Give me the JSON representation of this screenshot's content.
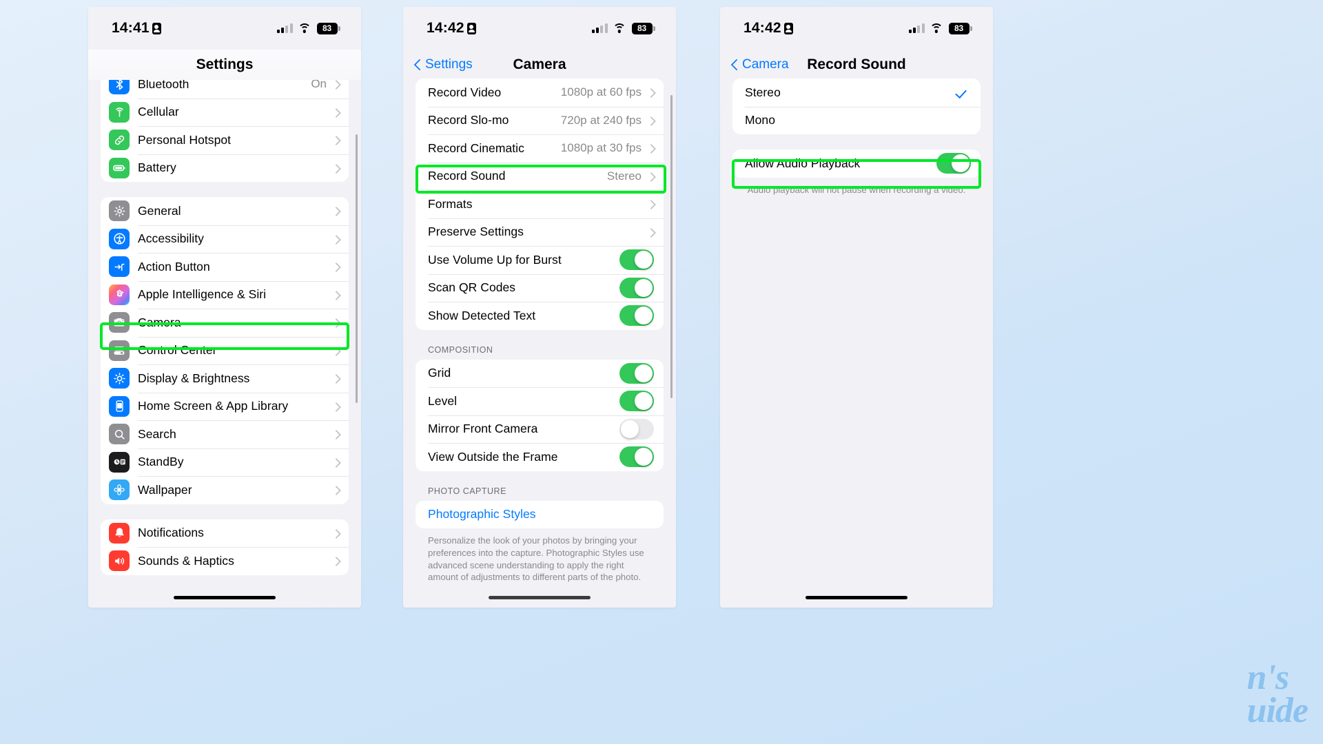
{
  "colors": {
    "accent_blue": "#047aff",
    "toggle_green": "#34c759",
    "highlight_green": "#00e826",
    "value_gray": "#8a8a8e",
    "page_bg": "#cfe4f8"
  },
  "watermark": {
    "line1": "n's",
    "line2": "uide"
  },
  "phone1": {
    "status": {
      "time": "14:41",
      "battery": "83",
      "lock_icon": "lock-portrait-icon",
      "signal_icon": "cellular-bars-icon",
      "wifi_icon": "wifi-icon"
    },
    "nav": {
      "title": "Settings"
    },
    "group1": [
      {
        "label": "Bluetooth",
        "value": "On",
        "icon": "bluetooth-icon",
        "icon_color": "#047aff"
      },
      {
        "label": "Cellular",
        "value": "",
        "icon": "cellular-antenna-icon",
        "icon_color": "#34c759"
      },
      {
        "label": "Personal Hotspot",
        "value": "",
        "icon": "hotspot-link-icon",
        "icon_color": "#34c759"
      },
      {
        "label": "Battery",
        "value": "",
        "icon": "battery-icon",
        "icon_color": "#34c759"
      }
    ],
    "group2": [
      {
        "label": "General",
        "value": "",
        "icon": "gear-icon",
        "icon_color": "#8e8e93"
      },
      {
        "label": "Accessibility",
        "value": "",
        "icon": "accessibility-icon",
        "icon_color": "#047aff"
      },
      {
        "label": "Action Button",
        "value": "",
        "icon": "action-button-icon",
        "icon_color": "#047aff"
      },
      {
        "label": "Apple Intelligence & Siri",
        "value": "",
        "icon": "apple-intelligence-icon",
        "icon_color": "gradient"
      },
      {
        "label": "Camera",
        "value": "",
        "icon": "camera-icon",
        "icon_color": "#8e8e93",
        "highlighted": true
      },
      {
        "label": "Control Center",
        "value": "",
        "icon": "control-center-icon",
        "icon_color": "#8e8e93"
      },
      {
        "label": "Display & Brightness",
        "value": "",
        "icon": "brightness-icon",
        "icon_color": "#047aff"
      },
      {
        "label": "Home Screen & App Library",
        "value": "",
        "icon": "home-screen-icon",
        "icon_color": "#047aff"
      },
      {
        "label": "Search",
        "value": "",
        "icon": "search-icon",
        "icon_color": "#8e8e93"
      },
      {
        "label": "StandBy",
        "value": "",
        "icon": "standby-icon",
        "icon_color": "#1c1c1e"
      },
      {
        "label": "Wallpaper",
        "value": "",
        "icon": "wallpaper-icon",
        "icon_color": "#33a8f5"
      }
    ],
    "group3": [
      {
        "label": "Notifications",
        "value": "",
        "icon": "notifications-bell-icon",
        "icon_color": "#ff3b30"
      },
      {
        "label": "Sounds & Haptics",
        "value": "",
        "icon": "sounds-speaker-icon",
        "icon_color": "#ff3b30"
      }
    ]
  },
  "phone2": {
    "status": {
      "time": "14:42",
      "battery": "83"
    },
    "nav": {
      "back_label": "Settings",
      "title": "Camera"
    },
    "group1": [
      {
        "label": "Record Video",
        "value": "1080p at 60 fps",
        "type": "disclosure"
      },
      {
        "label": "Record Slo-mo",
        "value": "720p at 240 fps",
        "type": "disclosure"
      },
      {
        "label": "Record Cinematic",
        "value": "1080p at 30 fps",
        "type": "disclosure"
      },
      {
        "label": "Record Sound",
        "value": "Stereo",
        "type": "disclosure",
        "highlighted": true
      },
      {
        "label": "Formats",
        "value": "",
        "type": "disclosure"
      },
      {
        "label": "Preserve Settings",
        "value": "",
        "type": "disclosure"
      },
      {
        "label": "Use Volume Up for Burst",
        "value": "",
        "type": "toggle",
        "on": true
      },
      {
        "label": "Scan QR Codes",
        "value": "",
        "type": "toggle",
        "on": true
      },
      {
        "label": "Show Detected Text",
        "value": "",
        "type": "toggle",
        "on": true
      }
    ],
    "section2_header": "COMPOSITION",
    "group2": [
      {
        "label": "Grid",
        "value": "",
        "type": "toggle",
        "on": true
      },
      {
        "label": "Level",
        "value": "",
        "type": "toggle",
        "on": true
      },
      {
        "label": "Mirror Front Camera",
        "value": "",
        "type": "toggle",
        "on": false
      },
      {
        "label": "View Outside the Frame",
        "value": "",
        "type": "toggle",
        "on": true
      }
    ],
    "section3_header": "PHOTO CAPTURE",
    "group3": [
      {
        "label": "Photographic Styles",
        "value": "",
        "type": "link"
      }
    ],
    "section3_footer": "Personalize the look of your photos by bringing your preferences into the capture. Photographic Styles use advanced scene understanding to apply the right amount of adjustments to different parts of the photo."
  },
  "phone3": {
    "status": {
      "time": "14:42",
      "battery": "83"
    },
    "nav": {
      "back_label": "Camera",
      "title": "Record Sound"
    },
    "group1": [
      {
        "label": "Stereo",
        "selected": true
      },
      {
        "label": "Mono",
        "selected": false
      }
    ],
    "group2": [
      {
        "label": "Allow Audio Playback",
        "type": "toggle",
        "on": true,
        "highlighted": true
      }
    ],
    "footer": "Audio playback will not pause when recording a video."
  }
}
